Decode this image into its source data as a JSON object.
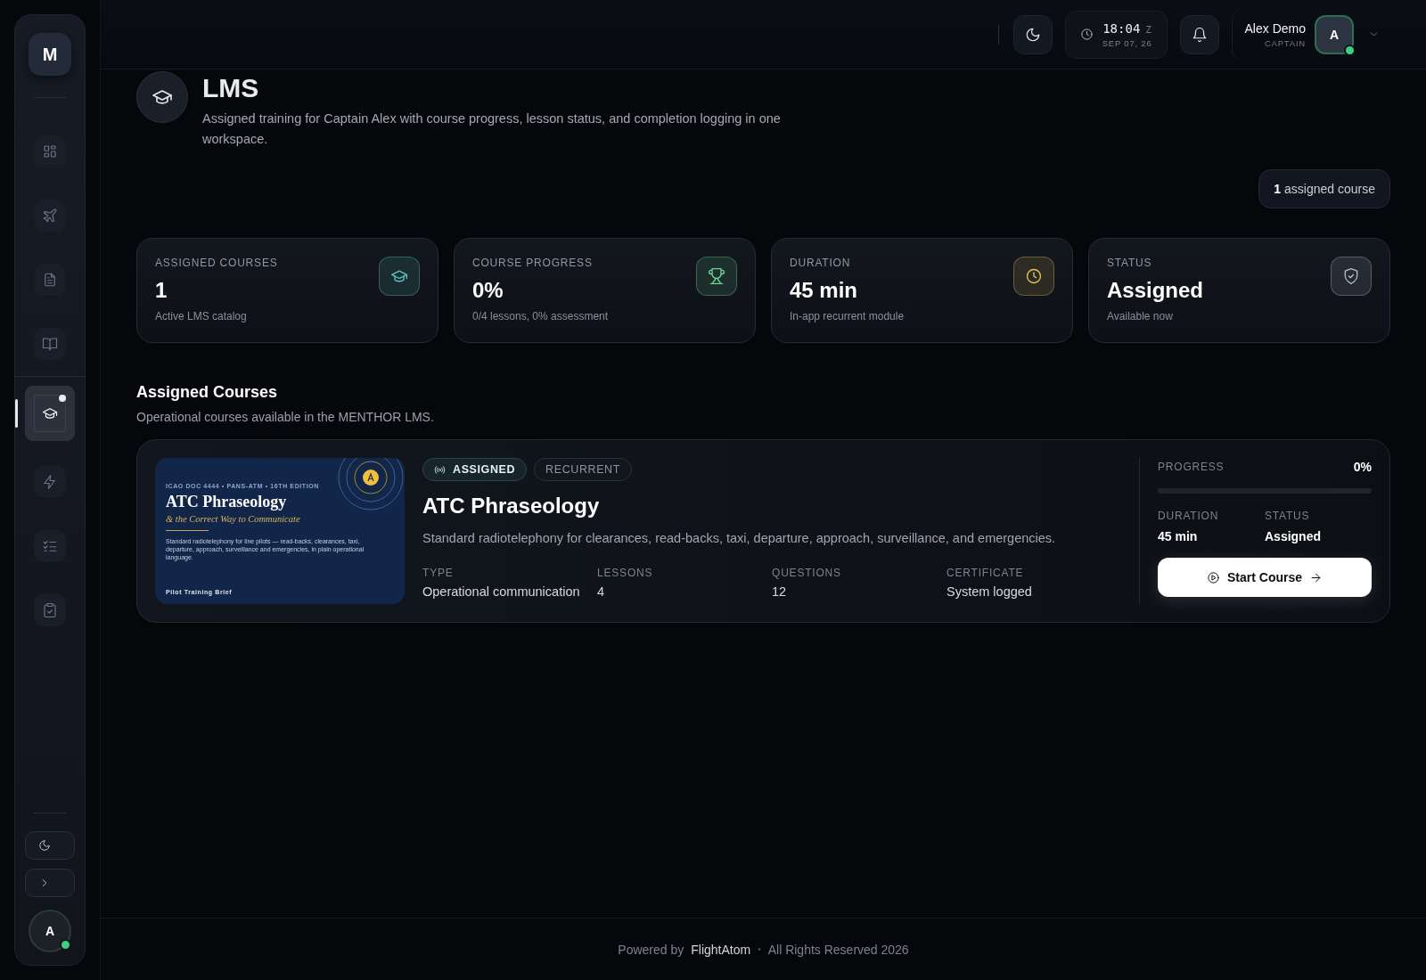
{
  "sidebar": {
    "logo": "M",
    "items": [
      {
        "kind": "grid",
        "selected": false,
        "dot": false
      },
      {
        "kind": "plane",
        "selected": false,
        "dot": false
      },
      {
        "kind": "document",
        "selected": false,
        "dot": false
      },
      {
        "kind": "book",
        "selected": false,
        "dot": false
      },
      {
        "kind": "graduation",
        "selected": true,
        "dot": true
      },
      {
        "kind": "bolt",
        "selected": false,
        "dot": false
      },
      {
        "kind": "checklist",
        "selected": false,
        "dot": false
      },
      {
        "kind": "clipboard",
        "selected": false,
        "dot": false
      }
    ],
    "avatar": {
      "initial": "A",
      "online": true
    }
  },
  "topbar": {
    "time": "18:04",
    "zone": "Z",
    "date": "SEP 07, 26",
    "user": {
      "name": "Alex Demo",
      "role": "CAPTAIN",
      "initial": "A",
      "online": true
    }
  },
  "page": {
    "title": "LMS",
    "description": "Assigned training for Captain Alex with course progress, lesson status, and completion logging in one workspace.",
    "badge": "**1** assigned course"
  },
  "stats": [
    {
      "label": "ASSIGNED COURSES",
      "value": "1",
      "sub": "Active LMS catalog",
      "kind": "graduation",
      "color": "#5fc9c0"
    },
    {
      "label": "COURSE PROGRESS",
      "value": "0%",
      "sub": "0/4 lessons, 0% assessment",
      "kind": "trophy",
      "color": "#6fd69a"
    },
    {
      "label": "DURATION",
      "value": "45 min",
      "sub": "In-app recurrent module",
      "kind": "clock",
      "color": "#e8c45a"
    },
    {
      "label": "STATUS",
      "value": "Assigned",
      "sub": "Available now",
      "kind": "shield",
      "color": "#b8bfcc"
    }
  ],
  "section": {
    "title": "Assigned Courses",
    "subtitle": "Operational courses available in the MENTHOR LMS."
  },
  "courses": [
    {
      "cover": {
        "kind": "picture",
        "eyebrow": "ICAO DOC 4444  •  PANS-ATM  •  16TH EDITION",
        "title": "ATC Phraseology",
        "subtitle": "& the Correct Way to Communicate",
        "blurb": "Standard radiotelephony for line pilots — read-backs, clearances, taxi, departure, approach, surveillance and emergencies, in plain operational language.",
        "footer": "Pilot Training Brief"
      },
      "tags": [
        {
          "label": "ASSIGNED",
          "kind": "status"
        },
        {
          "label": "RECURRENT",
          "kind": "plain"
        }
      ],
      "title": "ATC Phraseology",
      "description": "Standard radiotelephony for clearances, read-backs, taxi, departure, approach, surveillance, and emergencies.",
      "meta": [
        {
          "label": "TYPE",
          "value": "Operational communication"
        },
        {
          "label": "LESSONS",
          "value": "4"
        },
        {
          "label": "QUESTIONS",
          "value": "12"
        },
        {
          "label": "CERTIFICATE",
          "value": "System logged"
        }
      ],
      "progress": {
        "label": "PROGRESS",
        "reading": "0%",
        "level": 0
      },
      "facts": [
        {
          "label": "DURATION",
          "value": "45 min"
        },
        {
          "label": "STATUS",
          "value": "Assigned"
        }
      ],
      "button": "Start Course"
    }
  ],
  "footer": {
    "prefix": "Powered by",
    "brand": "FlightAtom",
    "separator": "•",
    "rights": "All Rights Reserved 2026"
  }
}
